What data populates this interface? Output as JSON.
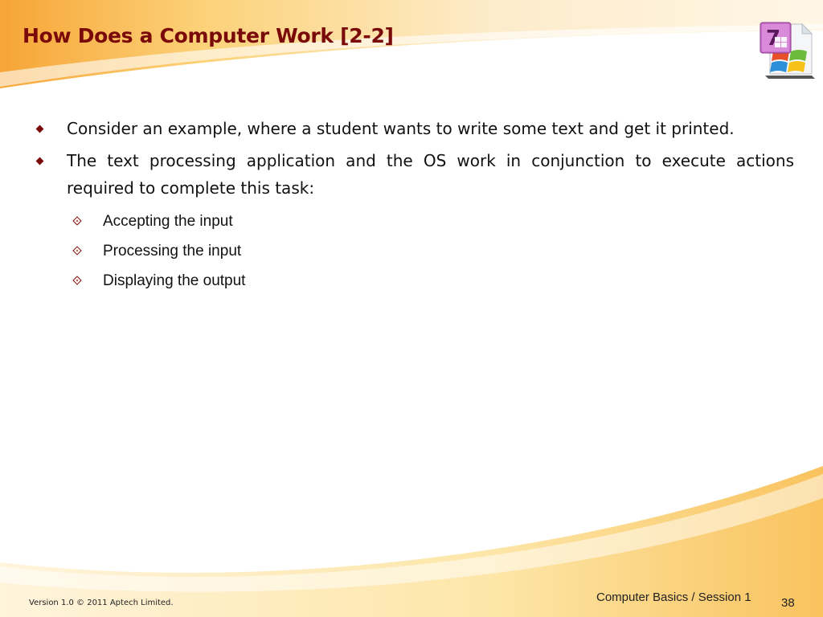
{
  "slide": {
    "title": "How Does a Computer Work [2-2]",
    "logo_icon": "windows-7-document-icon",
    "bullets": [
      {
        "text": "Consider an example, where a student wants to write some text and get it printed."
      },
      {
        "text": "The text processing application and the OS work in conjunction to execute actions required to complete this task:",
        "sub_bullets": [
          "Accepting the input",
          "Processing the input",
          "Displaying the output"
        ]
      }
    ]
  },
  "footer": {
    "version": "Version 1.0 © 2011 Aptech Limited.",
    "course": "Computer Basics / Session 1",
    "page_number": "38"
  },
  "colors": {
    "title": "#7a0a0a",
    "accent_orange": "#f7a93a",
    "accent_yellow": "#fde6a6"
  }
}
